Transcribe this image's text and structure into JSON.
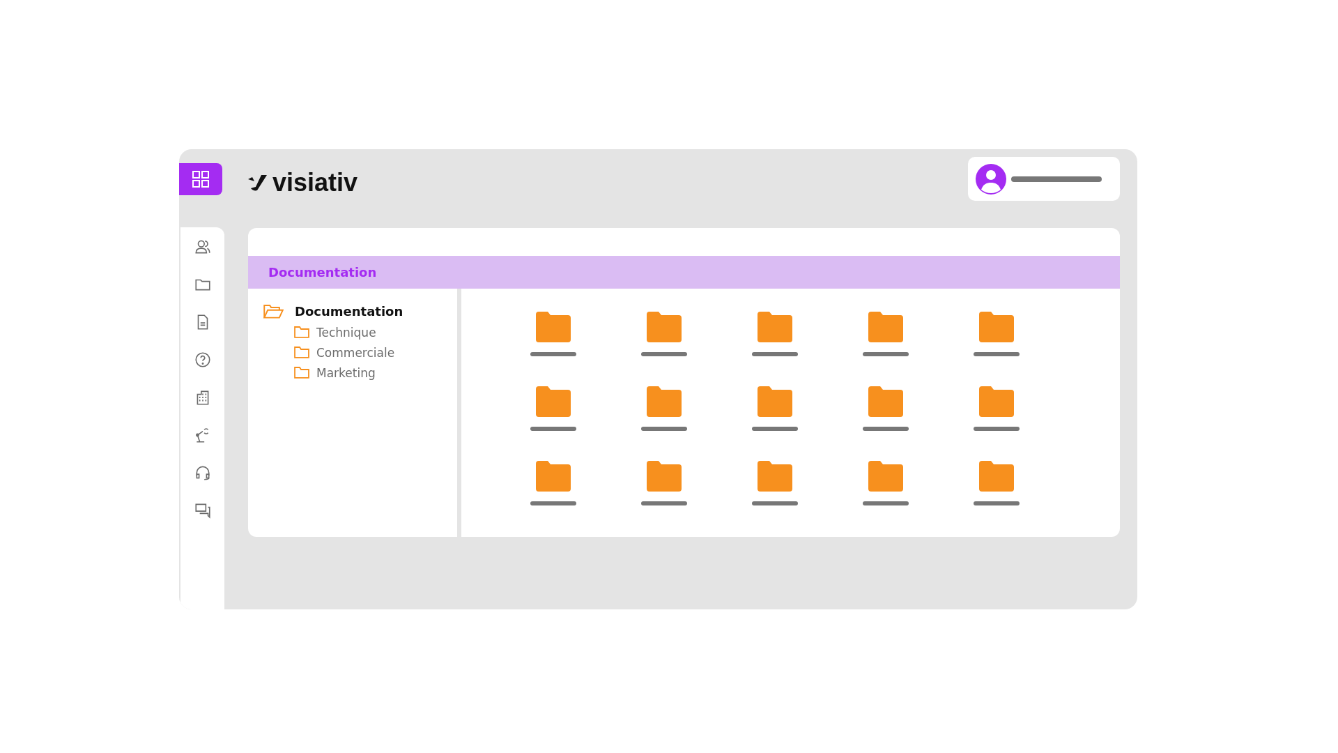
{
  "header": {
    "logo": "visiativ"
  },
  "panel": {
    "title": "Documentation"
  },
  "tree": [
    {
      "label": "Documentation",
      "expanded": true,
      "children": [
        {
          "label": "Technique",
          "expanded": false
        },
        {
          "label": "Commerciale",
          "expanded": false
        },
        {
          "label": "Marketing",
          "expanded": false
        }
      ]
    }
  ],
  "grid": {
    "items": [
      {
        "kind": "folder"
      },
      {
        "kind": "folder"
      },
      {
        "kind": "folder"
      },
      {
        "kind": "folder"
      },
      {
        "kind": "folder"
      },
      {
        "kind": "folder"
      },
      {
        "kind": "folder"
      },
      {
        "kind": "folder"
      },
      {
        "kind": "folder"
      },
      {
        "kind": "folder"
      },
      {
        "kind": "folder"
      },
      {
        "kind": "folder"
      },
      {
        "kind": "folder"
      },
      {
        "kind": "folder"
      },
      {
        "kind": "folder"
      }
    ]
  }
}
